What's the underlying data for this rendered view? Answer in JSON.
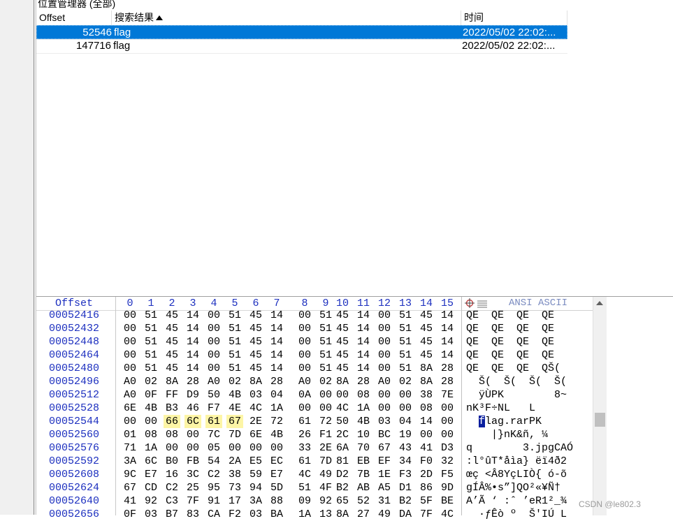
{
  "position_manager": {
    "title": "位置管理器 (全部)",
    "columns": {
      "offset": "Offset",
      "result": "搜索结果",
      "time": "时间"
    },
    "rows": [
      {
        "offset": "52546",
        "result": "flag",
        "time": "2022/05/02  22:02:...",
        "selected": true
      },
      {
        "offset": "147716",
        "result": "flag",
        "time": "2022/05/02  22:02:...",
        "selected": false
      }
    ]
  },
  "hex_editor": {
    "offset_label": "Offset",
    "columns": [
      "0",
      "1",
      "2",
      "3",
      "4",
      "5",
      "6",
      "7",
      "8",
      "9",
      "10",
      "11",
      "12",
      "13",
      "14",
      "15"
    ],
    "ascii_header": "ANSI ASCII",
    "highlight_offset": "00052546",
    "rows": [
      {
        "offset": "00052416",
        "bytes": [
          "00",
          "51",
          "45",
          "14",
          "00",
          "51",
          "45",
          "14",
          "00",
          "51",
          "45",
          "14",
          "00",
          "51",
          "45",
          "14"
        ],
        "ascii": "QE  QE  QE  QE"
      },
      {
        "offset": "00052432",
        "bytes": [
          "00",
          "51",
          "45",
          "14",
          "00",
          "51",
          "45",
          "14",
          "00",
          "51",
          "45",
          "14",
          "00",
          "51",
          "45",
          "14"
        ],
        "ascii": "QE  QE  QE  QE"
      },
      {
        "offset": "00052448",
        "bytes": [
          "00",
          "51",
          "45",
          "14",
          "00",
          "51",
          "45",
          "14",
          "00",
          "51",
          "45",
          "14",
          "00",
          "51",
          "45",
          "14"
        ],
        "ascii": "QE  QE  QE  QE"
      },
      {
        "offset": "00052464",
        "bytes": [
          "00",
          "51",
          "45",
          "14",
          "00",
          "51",
          "45",
          "14",
          "00",
          "51",
          "45",
          "14",
          "00",
          "51",
          "45",
          "14"
        ],
        "ascii": "QE  QE  QE  QE"
      },
      {
        "offset": "00052480",
        "bytes": [
          "00",
          "51",
          "45",
          "14",
          "00",
          "51",
          "45",
          "14",
          "00",
          "51",
          "45",
          "14",
          "00",
          "51",
          "8A",
          "28"
        ],
        "ascii": "QE  QE  QE  QŠ("
      },
      {
        "offset": "00052496",
        "bytes": [
          "A0",
          "02",
          "8A",
          "28",
          "A0",
          "02",
          "8A",
          "28",
          "A0",
          "02",
          "8A",
          "28",
          "A0",
          "02",
          "8A",
          "28"
        ],
        "ascii": "  Š(  Š(  Š(  Š("
      },
      {
        "offset": "00052512",
        "bytes": [
          "A0",
          "0F",
          "FF",
          "D9",
          "50",
          "4B",
          "03",
          "04",
          "0A",
          "00",
          "00",
          "08",
          "00",
          "00",
          "38",
          "7E"
        ],
        "ascii": "  ÿÙPK        8~"
      },
      {
        "offset": "00052528",
        "bytes": [
          "6E",
          "4B",
          "B3",
          "46",
          "F7",
          "4E",
          "4C",
          "1A",
          "00",
          "00",
          "4C",
          "1A",
          "00",
          "00",
          "08",
          "00"
        ],
        "ascii": "nK³F÷NL   L"
      },
      {
        "offset": "00052544",
        "bytes": [
          "00",
          "00",
          "66",
          "6C",
          "61",
          "67",
          "2E",
          "72",
          "61",
          "72",
          "50",
          "4B",
          "03",
          "04",
          "14",
          "00"
        ],
        "ascii_pre": "  ",
        "ascii_hl": "f",
        "ascii": "lag.rarPK"
      },
      {
        "offset": "00052560",
        "bytes": [
          "01",
          "08",
          "08",
          "00",
          "7C",
          "7D",
          "6E",
          "4B",
          "26",
          "F1",
          "2C",
          "10",
          "BC",
          "19",
          "00",
          "00"
        ],
        "ascii": "    |}nK&ñ, ¼"
      },
      {
        "offset": "00052576",
        "bytes": [
          "71",
          "1A",
          "00",
          "00",
          "05",
          "00",
          "00",
          "00",
          "33",
          "2E",
          "6A",
          "70",
          "67",
          "43",
          "41",
          "D3"
        ],
        "ascii": "q        3.jpgCAÓ"
      },
      {
        "offset": "00052592",
        "bytes": [
          "3A",
          "6C",
          "B0",
          "FB",
          "54",
          "2A",
          "E5",
          "EC",
          "61",
          "7D",
          "81",
          "EB",
          "EF",
          "34",
          "F0",
          "32"
        ],
        "ascii": ":l°ûT*åìa} ëï4ð2"
      },
      {
        "offset": "00052608",
        "bytes": [
          "9C",
          "E7",
          "16",
          "3C",
          "C2",
          "38",
          "59",
          "E7",
          "4C",
          "49",
          "D2",
          "7B",
          "1E",
          "F3",
          "2D",
          "F5"
        ],
        "ascii": "œç <Â8YçLIÒ{ ó-õ"
      },
      {
        "offset": "00052624",
        "bytes": [
          "67",
          "CD",
          "C2",
          "25",
          "95",
          "73",
          "94",
          "5D",
          "51",
          "4F",
          "B2",
          "AB",
          "A5",
          "D1",
          "86",
          "9D"
        ],
        "ascii": "gÍÂ%•s”]QO²«¥Ñ†"
      },
      {
        "offset": "00052640",
        "bytes": [
          "41",
          "92",
          "C3",
          "7F",
          "91",
          "17",
          "3A",
          "88",
          "09",
          "92",
          "65",
          "52",
          "31",
          "B2",
          "5F",
          "BE"
        ],
        "ascii": "A’Ã ‘ :ˆ ’eR1²_¾"
      },
      {
        "offset": "00052656",
        "bytes": [
          "0F",
          "03",
          "B7",
          "83",
          "CA",
          "F2",
          "03",
          "BA",
          "1A",
          "13",
          "8A",
          "27",
          "49",
          "DA",
          "7F",
          "4C"
        ],
        "ascii": "  ·ƒÊò º  Š'IÚ L"
      }
    ]
  },
  "watermark": "CSDN @le802.3",
  "colors": {
    "selection": "#0078d7",
    "offset_blue": "#1c2fbf",
    "byte_highlight": "#fdf5a6",
    "ascii_highlight": "#0a1f9e"
  }
}
